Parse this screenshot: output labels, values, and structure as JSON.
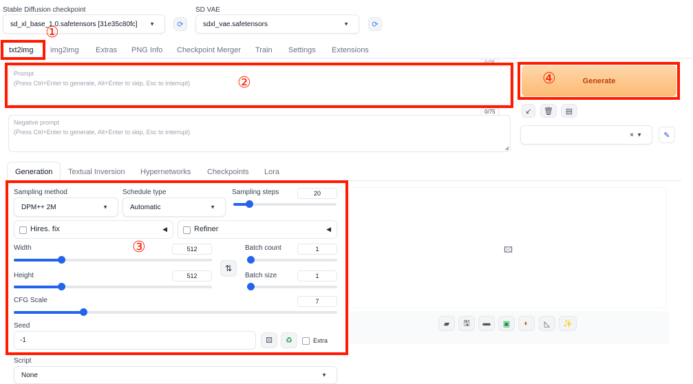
{
  "top": {
    "checkpoint_label": "Stable Diffusion checkpoint",
    "checkpoint_value": "sd_xl_base_1.0.safetensors [31e35c80fc]",
    "vae_label": "SD VAE",
    "vae_value": "sdxl_vae.safetensors"
  },
  "tabs": [
    "txt2img",
    "img2img",
    "Extras",
    "PNG Info",
    "Checkpoint Merger",
    "Train",
    "Settings",
    "Extensions"
  ],
  "prompt": {
    "label": "Prompt",
    "placeholder": "(Press Ctrl+Enter to generate, Alt+Enter to skip, Esc to interrupt)",
    "counter": "0/75"
  },
  "negative": {
    "label": "Negative prompt",
    "placeholder": "(Press Ctrl+Enter to generate, Alt+Enter to skip, Esc to interrupt)",
    "counter": "0/75"
  },
  "generate_label": "Generate",
  "styles_clear": "×",
  "subtabs": [
    "Generation",
    "Textual Inversion",
    "Hypernetworks",
    "Checkpoints",
    "Lora"
  ],
  "sampling": {
    "method_label": "Sampling method",
    "method_value": "DPM++ 2M",
    "schedule_label": "Schedule type",
    "schedule_value": "Automatic",
    "steps_label": "Sampling steps",
    "steps_value": "20",
    "steps_fraction": 0.13
  },
  "hires_label": "Hires. fix",
  "refiner_label": "Refiner",
  "width": {
    "label": "Width",
    "value": "512",
    "fraction": 0.23
  },
  "height": {
    "label": "Height",
    "value": "512",
    "fraction": 0.23
  },
  "batch_count": {
    "label": "Batch count",
    "value": "1",
    "fraction": 0.0
  },
  "batch_size": {
    "label": "Batch size",
    "value": "1",
    "fraction": 0.0
  },
  "cfg": {
    "label": "CFG Scale",
    "value": "7",
    "fraction": 0.21
  },
  "seed": {
    "label": "Seed",
    "value": "-1",
    "extra_label": "Extra"
  },
  "script": {
    "label": "Script",
    "value": "None"
  },
  "annotations": {
    "n1": "①",
    "n2": "②",
    "n3": "③",
    "n4": "④"
  },
  "colors": {
    "annotation_red": "#ff1a00",
    "generate_orange": "#fdba74",
    "slider_blue": "#2563eb"
  }
}
